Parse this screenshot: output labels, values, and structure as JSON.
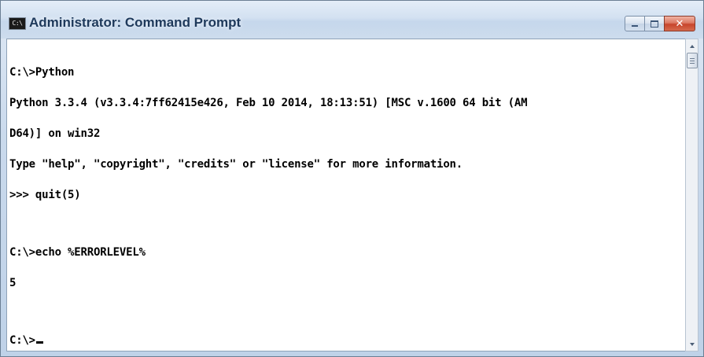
{
  "window": {
    "title": "Administrator: Command Prompt",
    "icon_label": "C:\\",
    "icon": "cmd-icon"
  },
  "caption_buttons": {
    "minimize_icon": "minimize-icon",
    "maximize_icon": "maximize-icon",
    "close_glyph": "✕"
  },
  "console": {
    "lines": [
      "C:\\>Python",
      "Python 3.3.4 (v3.3.4:7ff62415e426, Feb 10 2014, 18:13:51) [MSC v.1600 64 bit (AM",
      "D64)] on win32",
      "Type \"help\", \"copyright\", \"credits\" or \"license\" for more information.",
      ">>> quit(5)",
      "",
      "C:\\>echo %ERRORLEVEL%",
      "5",
      "",
      "C:\\>"
    ]
  },
  "colors": {
    "title_text": "#1e395b",
    "console_bg": "#ffffff",
    "console_text": "#000000",
    "close_button": "#c7452b"
  }
}
